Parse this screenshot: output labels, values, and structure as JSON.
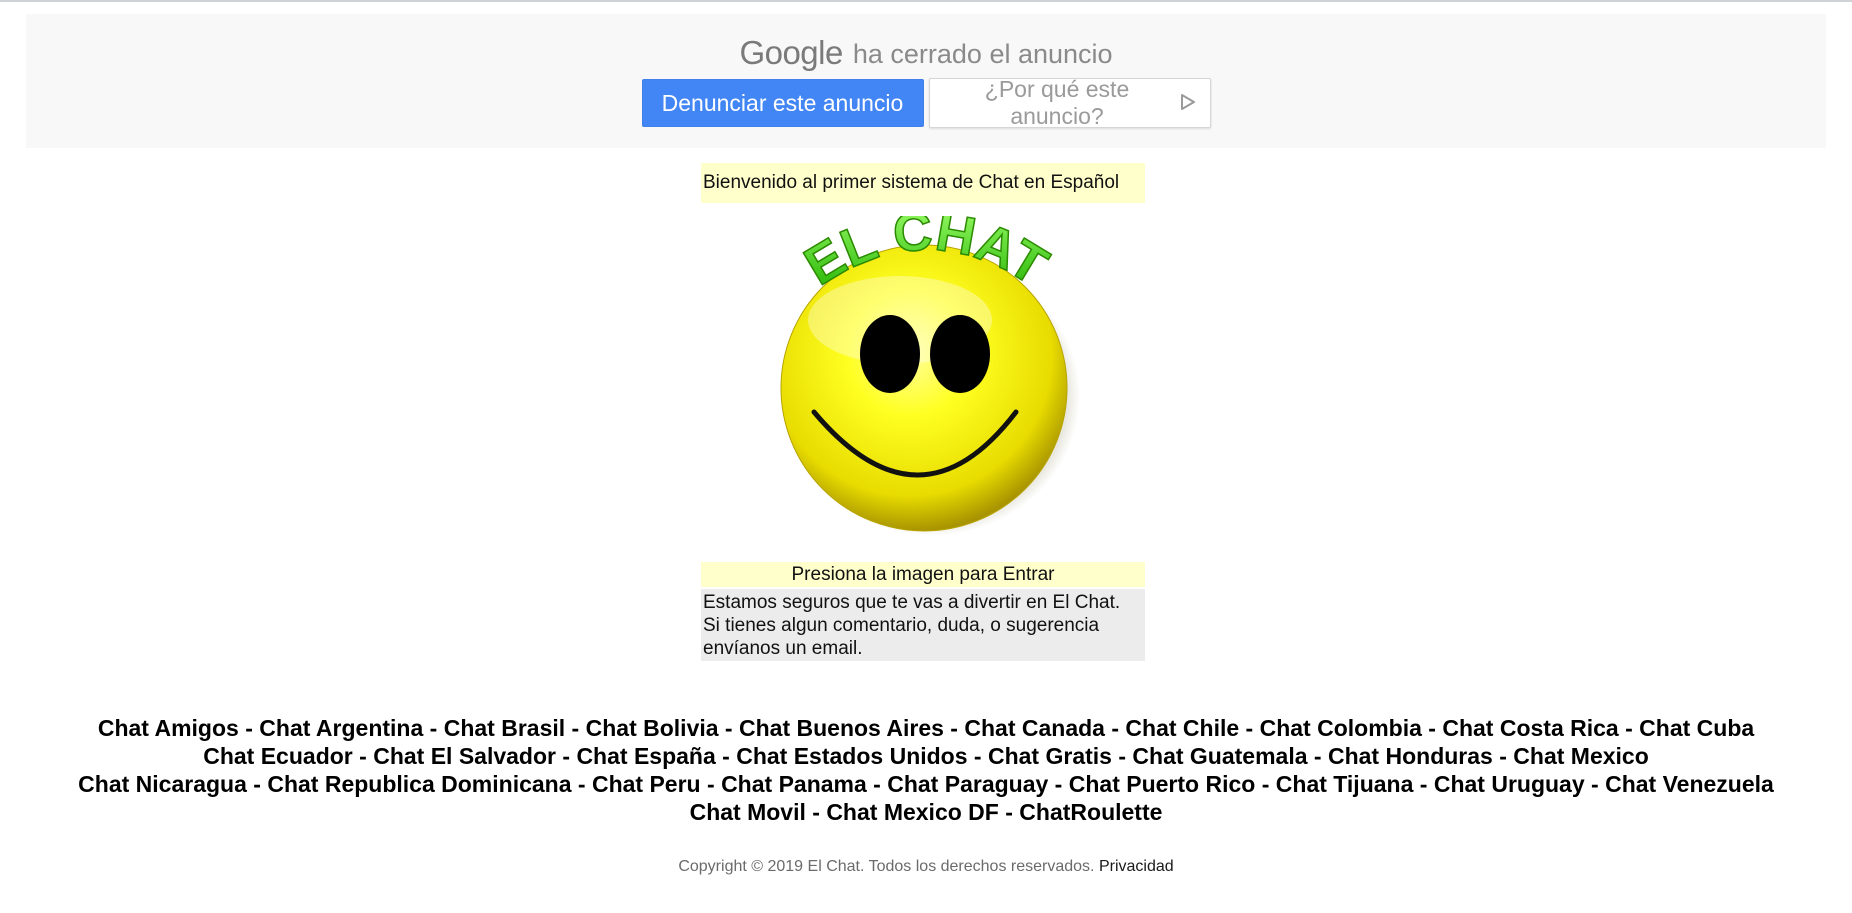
{
  "ad": {
    "google_word": "Google",
    "closed_text": "ha cerrado el anuncio",
    "report_button": "Denunciar este anuncio",
    "why_button": "¿Por qué este anuncio?",
    "play_icon": "play-outline-icon",
    "report_color": "#4285f4"
  },
  "welcome": "Bienvenido al primer sistema de Chat en Español",
  "logo": {
    "text": "EL CHAT",
    "icon": "smiley-face-icon"
  },
  "press_text": "Presiona la imagen para Entrar",
  "description": {
    "line1": "Estamos seguros que te vas a divertir en El Chat.",
    "line2": "Si tienes algun comentario, duda, o sugerencia",
    "line3": "envíanos un email."
  },
  "links": {
    "rows": [
      [
        "Chat Amigos",
        "Chat Argentina",
        "Chat Brasil",
        "Chat Bolivia",
        "Chat Buenos Aires",
        "Chat Canada",
        "Chat Chile",
        "Chat Colombia",
        "Chat Costa Rica",
        "Chat Cuba"
      ],
      [
        "Chat Ecuador",
        "Chat El Salvador",
        "Chat España",
        "Chat Estados Unidos",
        "Chat Gratis",
        "Chat Guatemala",
        "Chat Honduras",
        "Chat Mexico"
      ],
      [
        "Chat Nicaragua",
        "Chat Republica Dominicana",
        "Chat Peru",
        "Chat Panama",
        "Chat Paraguay",
        "Chat Puerto Rico",
        "Chat Tijuana",
        "Chat Uruguay",
        "Chat Venezuela"
      ],
      [
        "Chat Movil",
        "Chat Mexico DF",
        "ChatRoulette"
      ]
    ],
    "separator": " - "
  },
  "footer": {
    "copyright": "Copyright © 2019 El Chat. Todos los derechos reservados.",
    "privacy": "Privacidad"
  }
}
